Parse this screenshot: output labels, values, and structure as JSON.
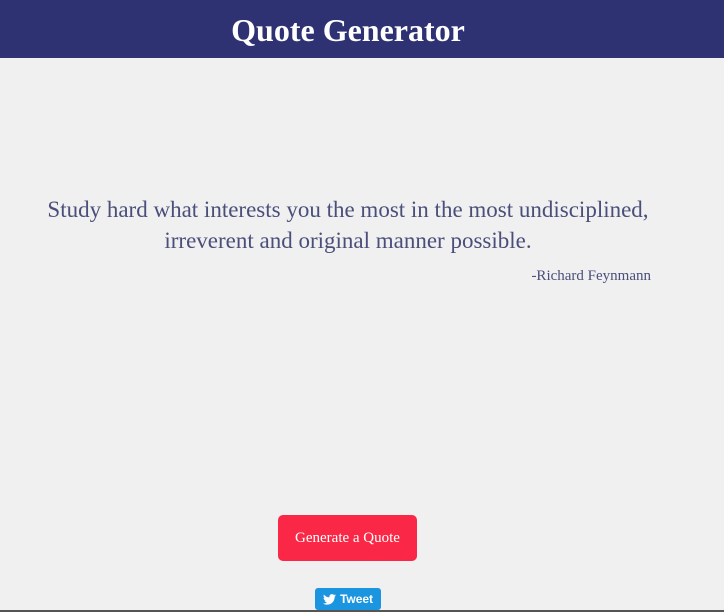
{
  "header": {
    "title": "Quote Generator"
  },
  "quote": {
    "text": "Study hard what interests you the most in the most undisciplined, irreverent and original manner possible.",
    "author": "-Richard Feynmann"
  },
  "actions": {
    "generate_label": "Generate a Quote",
    "tweet_label": "Tweet",
    "tweet_icon": "twitter-bird-icon"
  },
  "colors": {
    "header_bg": "#2e3272",
    "page_bg": "#f0f0f0",
    "quote_text": "#4a4f7a",
    "generate_button": "#fa2846",
    "tweet_button": "#1b95e0"
  }
}
